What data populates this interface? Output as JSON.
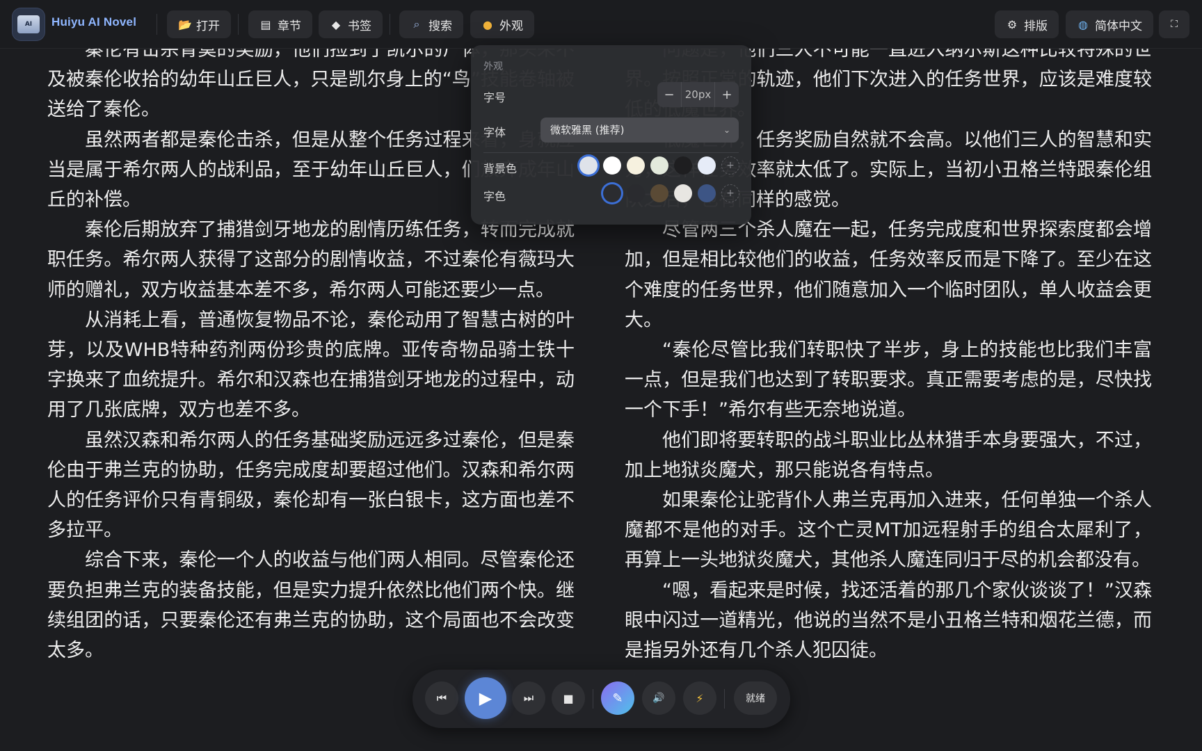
{
  "app": {
    "title": "Huiyu AI Novel"
  },
  "toolbar": {
    "left": [
      {
        "label": "打开",
        "icon": "folder-icon"
      },
      {
        "label": "章节",
        "icon": "document-icon"
      },
      {
        "label": "书签",
        "icon": "bookmark-icon"
      },
      {
        "label": "搜索",
        "icon": "search-icon"
      },
      {
        "label": "外观",
        "icon": "palette-icon"
      }
    ],
    "right": [
      {
        "label": "排版",
        "icon": "gear-icon"
      },
      {
        "label": "简体中文",
        "icon": "globe-icon"
      },
      {
        "label": "",
        "icon": "fullscreen-icon"
      }
    ]
  },
  "reader": {
    "left_paragraphs": [
      "秦伦有击杀青莫的奖励，他们捡到了凯尔的尸体，那头来不及被秦伦收拾的幼年山丘巨人，只是凯尔身上的“鸟”技能卷轴被送给了秦伦。",
      "虽然两者都是秦伦击杀，但是从整个任务过程来看，身就应当是属于希尔两人的战利品，至于幼年山丘巨人，们放弃成年山丘的补偿。",
      "秦伦后期放弃了捕猎剑牙地龙的剧情历练任务，转而完成就职任务。希尔两人获得了这部分的剧情收益，不过秦伦有薇玛大师的赠礼，双方收益基本差不多，希尔两人可能还要少一点。",
      "从消耗上看，普通恢复物品不论，秦伦动用了智慧古树的叶芽，以及WHB特种药剂两份珍贵的底牌。亚传奇物品骑士铁十字换来了血统提升。希尔和汉森也在捕猎剑牙地龙的过程中，动用了几张底牌，双方也差不多。",
      "虽然汉森和希尔两人的任务基础奖励远远多过秦伦，但是秦伦由于弗兰克的协助，任务完成度却要超过他们。汉森和希尔两人的任务评价只有青铜级，秦伦却有一张白银卡，这方面也差不多拉平。",
      "综合下来，秦伦一个人的收益与他们两人相同。尽管秦伦还要负担弗兰克的装备技能，但是实力提升依然比他们两个快。继续组团的话，只要秦伦还有弗兰克的协助，这个局面也不会改变太多。"
    ],
    "right_paragraphs": [
      "问题是，他们三人不可能一直进入纳尔斯这种比较特殊的世界。按照正常的轨迹，他们下次进入的任务世界，应该是难度较低的低魔世界。",
      "低魔世界，任务奖励自然就不会高。以他们三人的智慧和实力，这样任务效率就太低了。实际上，当初小丑格兰特跟秦伦组队之后，也有同样的感觉。",
      "尽管两三个杀人魔在一起，任务完成度和世界探索度都会增加，但是相比较他们的收益，任务效率反而是下降了。至少在这个难度的任务世界，他们随意加入一个临时团队，单人收益会更大。",
      "“秦伦尽管比我们转职快了半步，身上的技能也比我们丰富一点，但是我们也达到了转职要求。真正需要考虑的是，尽快找一个下手！”希尔有些无奈地说道。",
      "他们即将要转职的战斗职业比丛林猎手本身要强大，不过，加上地狱炎魔犬，那只能说各有特点。",
      "如果秦伦让驼背仆人弗兰克再加入进来，任何单独一个杀人魔都不是他的对手。这个亡灵MT加远程射手的组合太犀利了，再算上一头地狱炎魔犬，其他杀人魔连同归于尽的机会都没有。",
      "“嗯，看起来是时候，找还活着的那几个家伙谈谈了！”汉森眼中闪过一道精光，他说的当然不是小丑格兰特和烟花兰德，而是指另外还有几个杀人犯囚徒。"
    ]
  },
  "appearance_panel": {
    "title": "外观",
    "font_size_label": "字号",
    "font_size_value": "20px",
    "decrease": "−",
    "increase": "+",
    "font_label": "字体",
    "font_value": "微软雅黑 (推荐)",
    "bg_label": "背景色",
    "bg_colors": [
      "#dfe3ea",
      "#ffffff",
      "#f6f1df",
      "#e3eadc",
      "#1e1e20",
      "#e6ecf8"
    ],
    "bg_selected": 0,
    "text_label": "字色",
    "text_colors": [
      "#2b2c30",
      "#2a2b2f",
      "#5a4a35",
      "#e8e6e2",
      "#3d5585"
    ],
    "text_selected": 0,
    "add_symbol": "+"
  },
  "player": {
    "prev_icon": "⏮",
    "play_icon": "▶",
    "next_icon": "⏭",
    "stop_icon": "■",
    "volume_icon": "🔊",
    "flash_icon": "⚡",
    "status": "就绪"
  }
}
